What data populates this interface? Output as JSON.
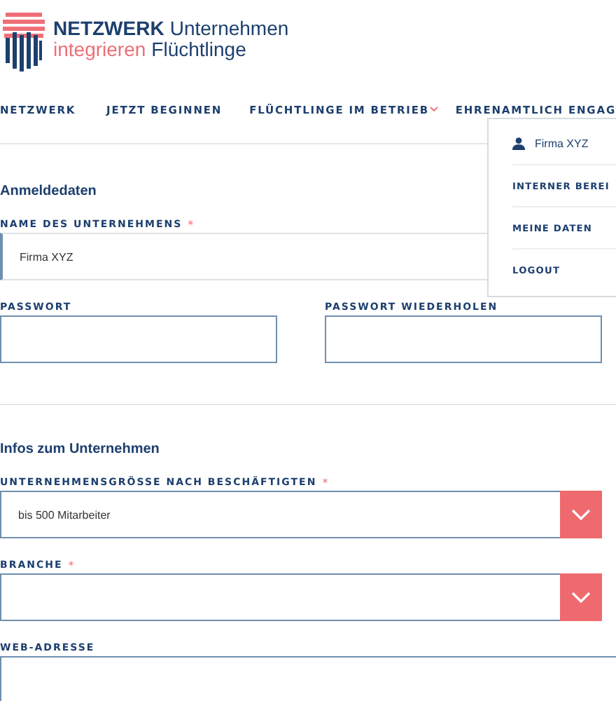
{
  "logo": {
    "brand": "NETZWERK",
    "brand_rest": "Unternehmen",
    "tag_a": "integrieren",
    "tag_b": "Flüchtlinge"
  },
  "nav": [
    {
      "label": "NETZWERK",
      "has_caret": false
    },
    {
      "label": "JETZT BEGINNEN",
      "has_caret": false
    },
    {
      "label": "FLÜCHTLINGE IM BETRIEB",
      "has_caret": true
    },
    {
      "label": "EHRENAMTLICH ENGAG",
      "has_caret": false
    }
  ],
  "user_menu": {
    "user": "Firma XYZ",
    "items": [
      "INTERNER BEREI",
      "MEINE DATEN",
      "LOGOUT"
    ]
  },
  "sections": [
    {
      "title": "Anmeldedaten",
      "rows": [
        [
          {
            "kind": "text",
            "label": "NAME DES UNTERNEHMENS",
            "required_mark": "*",
            "value": "Firma XYZ"
          }
        ],
        [
          {
            "kind": "password",
            "label": "PASSWORT"
          },
          {
            "kind": "password",
            "label": "PASSWORT WIEDERHOLEN"
          }
        ]
      ]
    },
    {
      "title": "Infos zum Unternehmen",
      "rows": [
        [
          {
            "kind": "select",
            "label": "UNTERNEHMENSGRÖSSE NACH BESCHÄFTIGTEN",
            "required_mark": "*",
            "value": "bis 500 Mitarbeiter"
          }
        ],
        [
          {
            "kind": "select",
            "label": "BRANCHE",
            "required_mark": "*"
          }
        ],
        [
          {
            "kind": "text",
            "label": "WEB-ADRESSE"
          }
        ]
      ]
    }
  ]
}
